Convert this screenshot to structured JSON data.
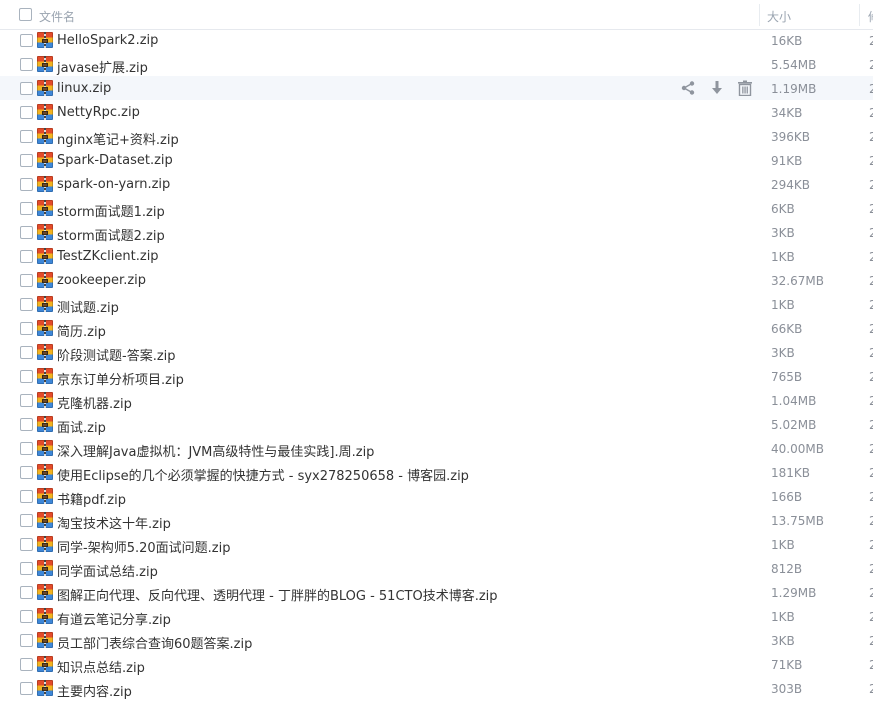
{
  "header": {
    "name_label": "文件名",
    "size_label": "大小",
    "date_label_truncated": "修"
  },
  "files": [
    {
      "name": "HelloSpark2.zip",
      "size": "16KB"
    },
    {
      "name": "javase扩展.zip",
      "size": "5.54MB"
    },
    {
      "name": "linux.zip",
      "size": "1.19MB",
      "hover": true
    },
    {
      "name": "NettyRpc.zip",
      "size": "34KB"
    },
    {
      "name": "nginx笔记+资料.zip",
      "size": "396KB"
    },
    {
      "name": "Spark-Dataset.zip",
      "size": "91KB"
    },
    {
      "name": "spark-on-yarn.zip",
      "size": "294KB"
    },
    {
      "name": "storm面试题1.zip",
      "size": "6KB"
    },
    {
      "name": "storm面试题2.zip",
      "size": "3KB"
    },
    {
      "name": "TestZKclient.zip",
      "size": "1KB"
    },
    {
      "name": "zookeeper.zip",
      "size": "32.67MB"
    },
    {
      "name": "测试题.zip",
      "size": "1KB"
    },
    {
      "name": "简历.zip",
      "size": "66KB"
    },
    {
      "name": "阶段测试题-答案.zip",
      "size": "3KB"
    },
    {
      "name": "京东订单分析项目.zip",
      "size": "765B"
    },
    {
      "name": "克隆机器.zip",
      "size": "1.04MB"
    },
    {
      "name": "面试.zip",
      "size": "5.02MB"
    },
    {
      "name": "深入理解Java虚拟机：JVM高级特性与最佳实践].周.zip",
      "size": "40.00MB"
    },
    {
      "name": "使用Eclipse的几个必须掌握的快捷方式 - syx278250658 - 博客园.zip",
      "size": "181KB"
    },
    {
      "name": "书籍pdf.zip",
      "size": "166B"
    },
    {
      "name": "淘宝技术这十年.zip",
      "size": "13.75MB"
    },
    {
      "name": "同学-架构师5.20面试问题.zip",
      "size": "1KB"
    },
    {
      "name": "同学面试总结.zip",
      "size": "812B"
    },
    {
      "name": "图解正向代理、反向代理、透明代理 - 丁胖胖的BLOG - 51CTO技术博客.zip",
      "size": "1.29MB"
    },
    {
      "name": "有道云笔记分享.zip",
      "size": "1KB"
    },
    {
      "name": "员工部门表综合查询60题答案.zip",
      "size": "3KB"
    },
    {
      "name": "知识点总结.zip",
      "size": "71KB"
    },
    {
      "name": "主要内容.zip",
      "size": "303B"
    }
  ],
  "date_truncated_glyph": "2",
  "icons": {
    "file_type": "zip-archive-icon",
    "actions": [
      "share-icon",
      "download-icon",
      "delete-icon"
    ]
  },
  "colors": {
    "header_text": "#9aa4b0",
    "row_text": "#333333",
    "size_text": "#8a8f98",
    "hover_bg": "#f4f7fb",
    "action_icon": "#8f959e"
  }
}
